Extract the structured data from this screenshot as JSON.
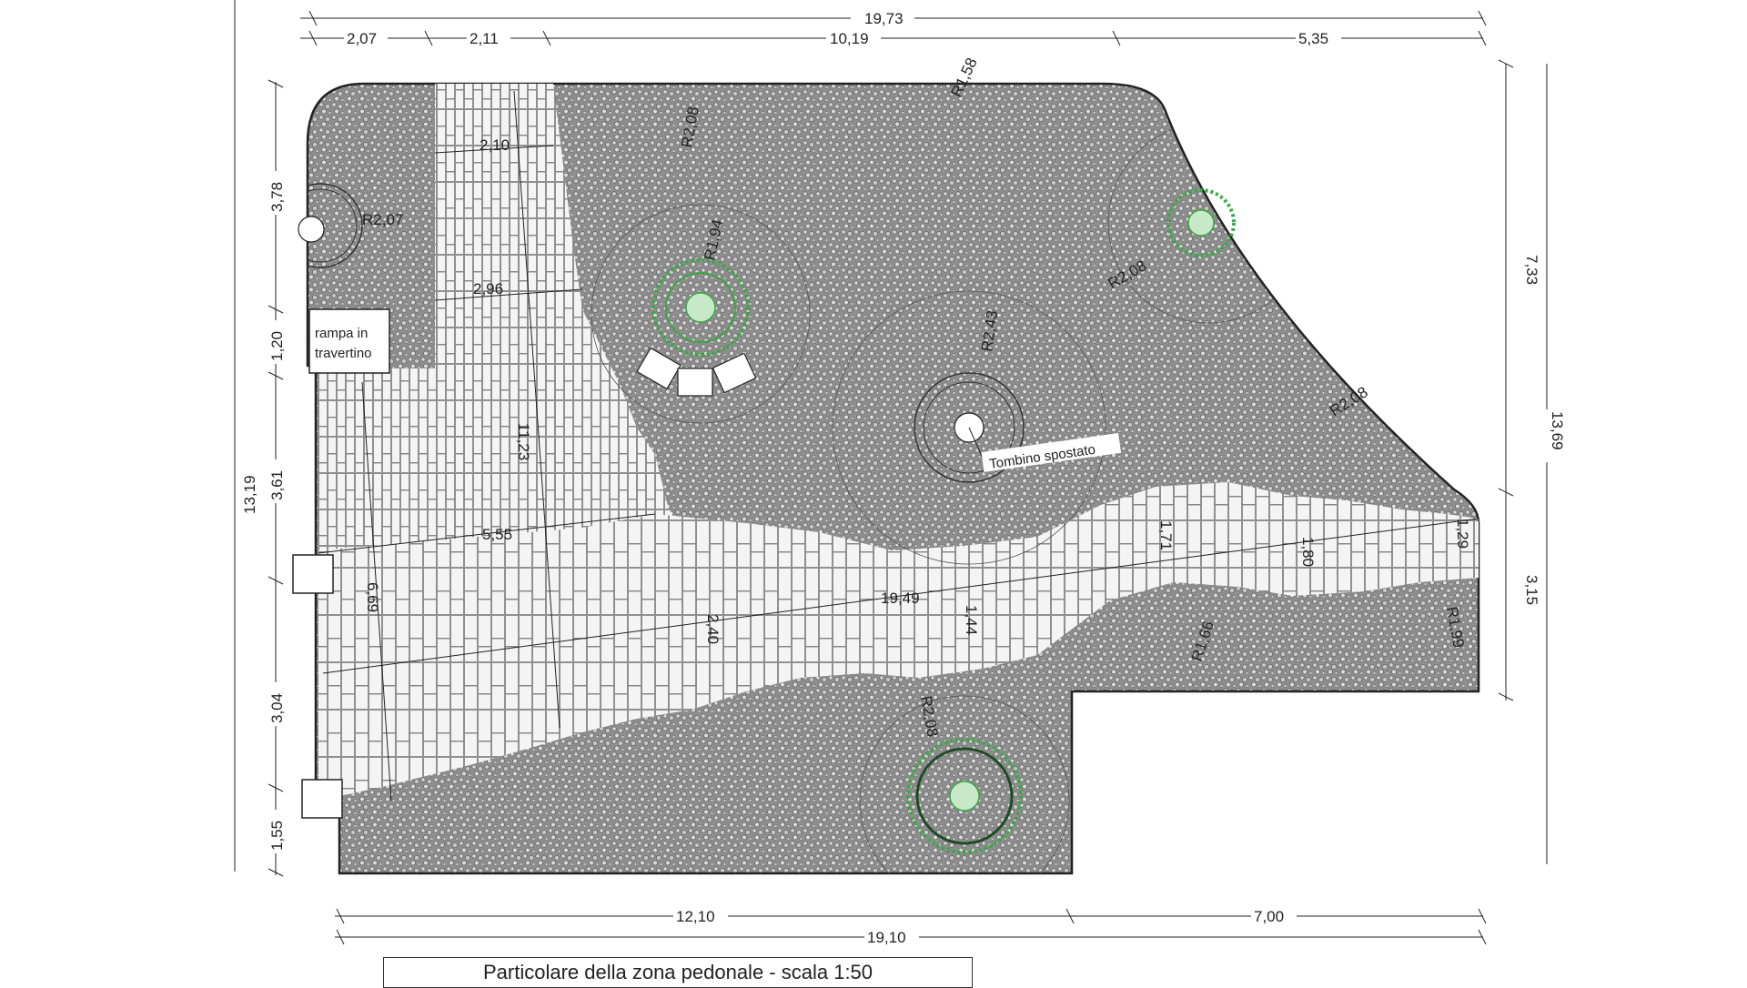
{
  "drawing": {
    "caption": "Particolare della zona pedonale   -  scala 1:50",
    "labels": {
      "ramp_line1": "rampa in",
      "ramp_line2": "travertino",
      "drain": "Tombino spostato"
    },
    "top_dimensions": {
      "overall": "19,73",
      "segment_1": "2,07",
      "segment_2": "2,11",
      "segment_3": "10,19",
      "segment_4": "5,35"
    },
    "bottom_dimensions": {
      "segment_1": "12,10",
      "segment_2": "7,00",
      "overall": "19,10"
    },
    "left_dimensions": {
      "overall": "13,19",
      "segment_1": "3,78",
      "segment_2": "1,20",
      "segment_3": "3,61",
      "segment_4": "3,04",
      "segment_5": "1,55"
    },
    "right_dimensions": {
      "overall": "13,69",
      "segment_1": "7,33",
      "segment_2": "3,15"
    },
    "internal_dimensions": {
      "path_width_top": "2,10",
      "path_offset": "2,96",
      "path_length": "11,23",
      "cross_width": "5,55",
      "diagonal_length": "19,49",
      "left_strip": "6,69",
      "strip_a": "2,40",
      "strip_b": "1,44",
      "strip_c": "1,71",
      "strip_d": "1,80",
      "strip_e": "1,29"
    },
    "radii": {
      "r_top_left": "R2,07",
      "r_upper_circle": "R2,08",
      "r_top": "R1,58",
      "r_tree_left": "R1,94",
      "r_tree_right": "R2,08",
      "r_center": "R2,43",
      "r_right_edge": "R2,08",
      "r_bottom_mid": "R1,66",
      "r_bottom_right": "R1,99",
      "r_bottom_tree": "R2,08"
    },
    "colors": {
      "line": "#222222",
      "gravel_fill": "#8e8e8e",
      "paving_fill": "#f4f4f4",
      "tree": "#3aa845"
    }
  }
}
